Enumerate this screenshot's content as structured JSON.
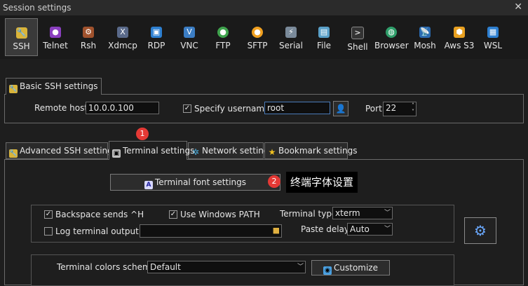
{
  "window": {
    "title": "Session settings",
    "close": "✕"
  },
  "toolbar": {
    "items": [
      {
        "label": "SSH"
      },
      {
        "label": "Telnet"
      },
      {
        "label": "Rsh"
      },
      {
        "label": "Xdmcp"
      },
      {
        "label": "RDP"
      },
      {
        "label": "VNC"
      },
      {
        "label": "FTP"
      },
      {
        "label": "SFTP"
      },
      {
        "label": "Serial"
      },
      {
        "label": "File"
      },
      {
        "label": "Shell"
      },
      {
        "label": "Browser"
      },
      {
        "label": "Mosh"
      },
      {
        "label": "Aws S3"
      },
      {
        "label": "WSL"
      }
    ]
  },
  "basic": {
    "tab": "Basic SSH settings",
    "remote_host_label": "Remote host *",
    "remote_host_value": "10.0.0.100",
    "specify_username_label": "Specify username",
    "username_value": "root",
    "port_label": "Port",
    "port_value": "22"
  },
  "tabs": {
    "advanced": "Advanced SSH settings",
    "terminal": "Terminal settings",
    "network": "Network settings",
    "bookmark": "Bookmark settings"
  },
  "terminal": {
    "font_button": "Terminal font settings",
    "backspace_label": "Backspace sends ^H",
    "use_windows_path_label": "Use Windows PATH",
    "terminal_type_label": "Terminal type:",
    "terminal_type_value": "xterm",
    "log_output_label": "Log terminal output to:",
    "paste_delay_label": "Paste delay:",
    "paste_delay_value": "Auto",
    "colors_scheme_label": "Terminal colors scheme:",
    "colors_scheme_value": "Default",
    "customize_button": "Customize"
  },
  "annotations": {
    "badge1": "1",
    "badge2": "2",
    "note": "终端字体设置"
  }
}
